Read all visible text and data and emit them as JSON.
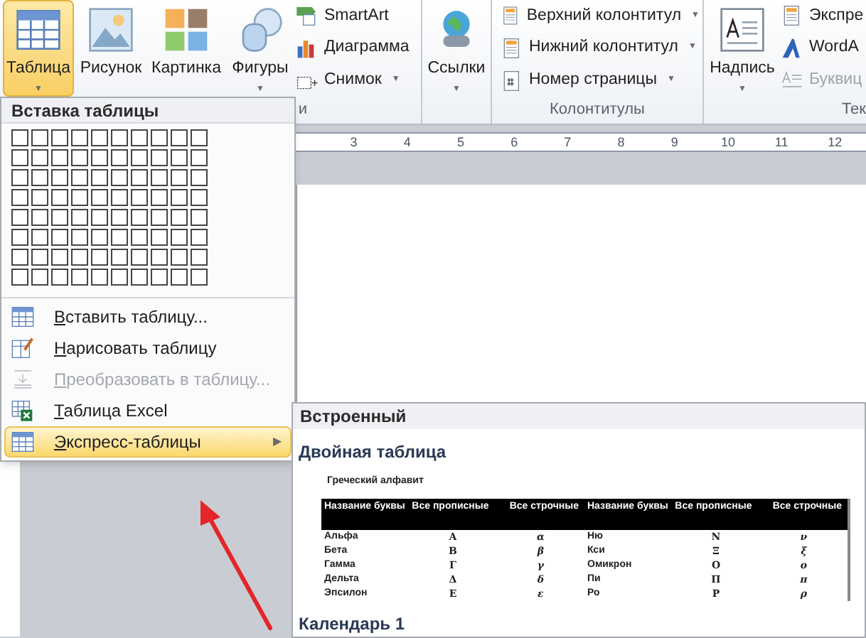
{
  "ribbon": {
    "large_buttons": [
      {
        "label": "Таблица",
        "selected": true,
        "caret": "▼"
      },
      {
        "label": "Рисунок",
        "selected": false
      },
      {
        "label": "Картинка",
        "selected": false
      },
      {
        "label": "Фигуры",
        "selected": false,
        "caret": "▼"
      }
    ],
    "small_column_1": [
      {
        "label": "SmartArt"
      },
      {
        "label": "Диаграмма"
      },
      {
        "label": "Снимок",
        "caret": "▼"
      }
    ],
    "group_label_1": "и",
    "links_button": {
      "label": "Ссылки",
      "caret": "▼"
    },
    "small_column_2": [
      {
        "label": "Верхний колонтитул",
        "caret": "▼"
      },
      {
        "label": "Нижний колонтитул",
        "caret": "▼"
      },
      {
        "label": "Номер страницы",
        "caret": "▼"
      }
    ],
    "group_label_2": "Колонтитулы",
    "textbox_button": {
      "label": "Надпись",
      "caret": "▼"
    },
    "small_column_3": [
      {
        "label": "Экспре",
        "disabled": false
      },
      {
        "label": "WordA",
        "disabled": false
      },
      {
        "label": "Буквиц",
        "disabled": true
      }
    ],
    "group_label_3": "Тек"
  },
  "ruler": {
    "labels": [
      "3",
      "4",
      "5",
      "6",
      "7",
      "8",
      "9",
      "10",
      "11",
      "12"
    ]
  },
  "table_menu": {
    "title": "Вставка таблицы",
    "items": [
      {
        "label": "Вставить таблицу...",
        "disabled": false,
        "selected": false
      },
      {
        "label": "Нарисовать таблицу",
        "disabled": false,
        "selected": false
      },
      {
        "label": "Преобразовать в таблицу...",
        "disabled": true,
        "selected": false
      },
      {
        "label": "Таблица Excel",
        "disabled": false,
        "selected": false
      },
      {
        "label": "Экспресс-таблицы",
        "disabled": false,
        "selected": true,
        "arrow": "▶"
      }
    ]
  },
  "quick_tables": {
    "section": "Встроенный",
    "templates": [
      {
        "title": "Двойная таблица",
        "preview": {
          "caption": "Греческий алфавит",
          "columns": [
            "Название буквы",
            "Все прописные",
            "Все строчные",
            "Название буквы",
            "Все прописные",
            "Все строчные"
          ],
          "rows": [
            [
              "Альфа",
              "Α",
              "α",
              "Ню",
              "Ν",
              "ν"
            ],
            [
              "Бета",
              "Β",
              "β",
              "Кси",
              "Ξ",
              "ξ"
            ],
            [
              "Гамма",
              "Γ",
              "γ",
              "Омикрон",
              "Ο",
              "ο"
            ],
            [
              "Дельта",
              "Δ",
              "δ",
              "Пи",
              "Π",
              "π"
            ],
            [
              "Эпсилон",
              "Ε",
              "ε",
              "Ро",
              "Ρ",
              "ρ"
            ]
          ]
        }
      },
      {
        "title": "Календарь 1"
      }
    ]
  }
}
